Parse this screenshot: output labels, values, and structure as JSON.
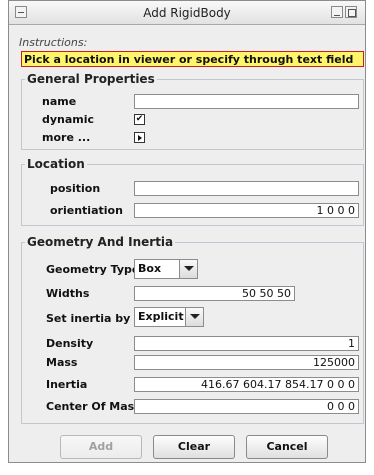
{
  "window": {
    "title": "Add RigidBody"
  },
  "instructions": {
    "label": "Instructions:",
    "text": "Pick a location in viewer or specify through text field"
  },
  "general": {
    "legend": "General Properties",
    "name_label": "name",
    "name_value": "",
    "dynamic_label": "dynamic",
    "dynamic_checked": true,
    "dynamic_mark": "✔",
    "more_label": "more ..."
  },
  "location": {
    "legend": "Location",
    "position_label": "position",
    "position_value": "",
    "orientation_label": "orientiation",
    "orientation_value": "1 0 0 0"
  },
  "geometry": {
    "legend": "Geometry And Inertia",
    "type_label": "Geometry Type",
    "type_value": "Box",
    "widths_label": "Widths",
    "widths_value": "50 50 50",
    "inertia_by_label": "Set inertia by",
    "inertia_by_value": "Explicit",
    "density_label": "Density",
    "density_value": "1",
    "mass_label": "Mass",
    "mass_value": "125000",
    "inertia_label": "Inertia",
    "inertia_value": "416.67 604.17 854.17 0 0 0",
    "com_label": "Center Of Mass",
    "com_value": "0 0 0"
  },
  "buttons": {
    "add": "Add",
    "clear": "Clear",
    "cancel": "Cancel"
  },
  "colors": {
    "instructions_bg": "#fff56b",
    "instructions_border": "#c42020",
    "window_bg": "#eeeeee"
  }
}
